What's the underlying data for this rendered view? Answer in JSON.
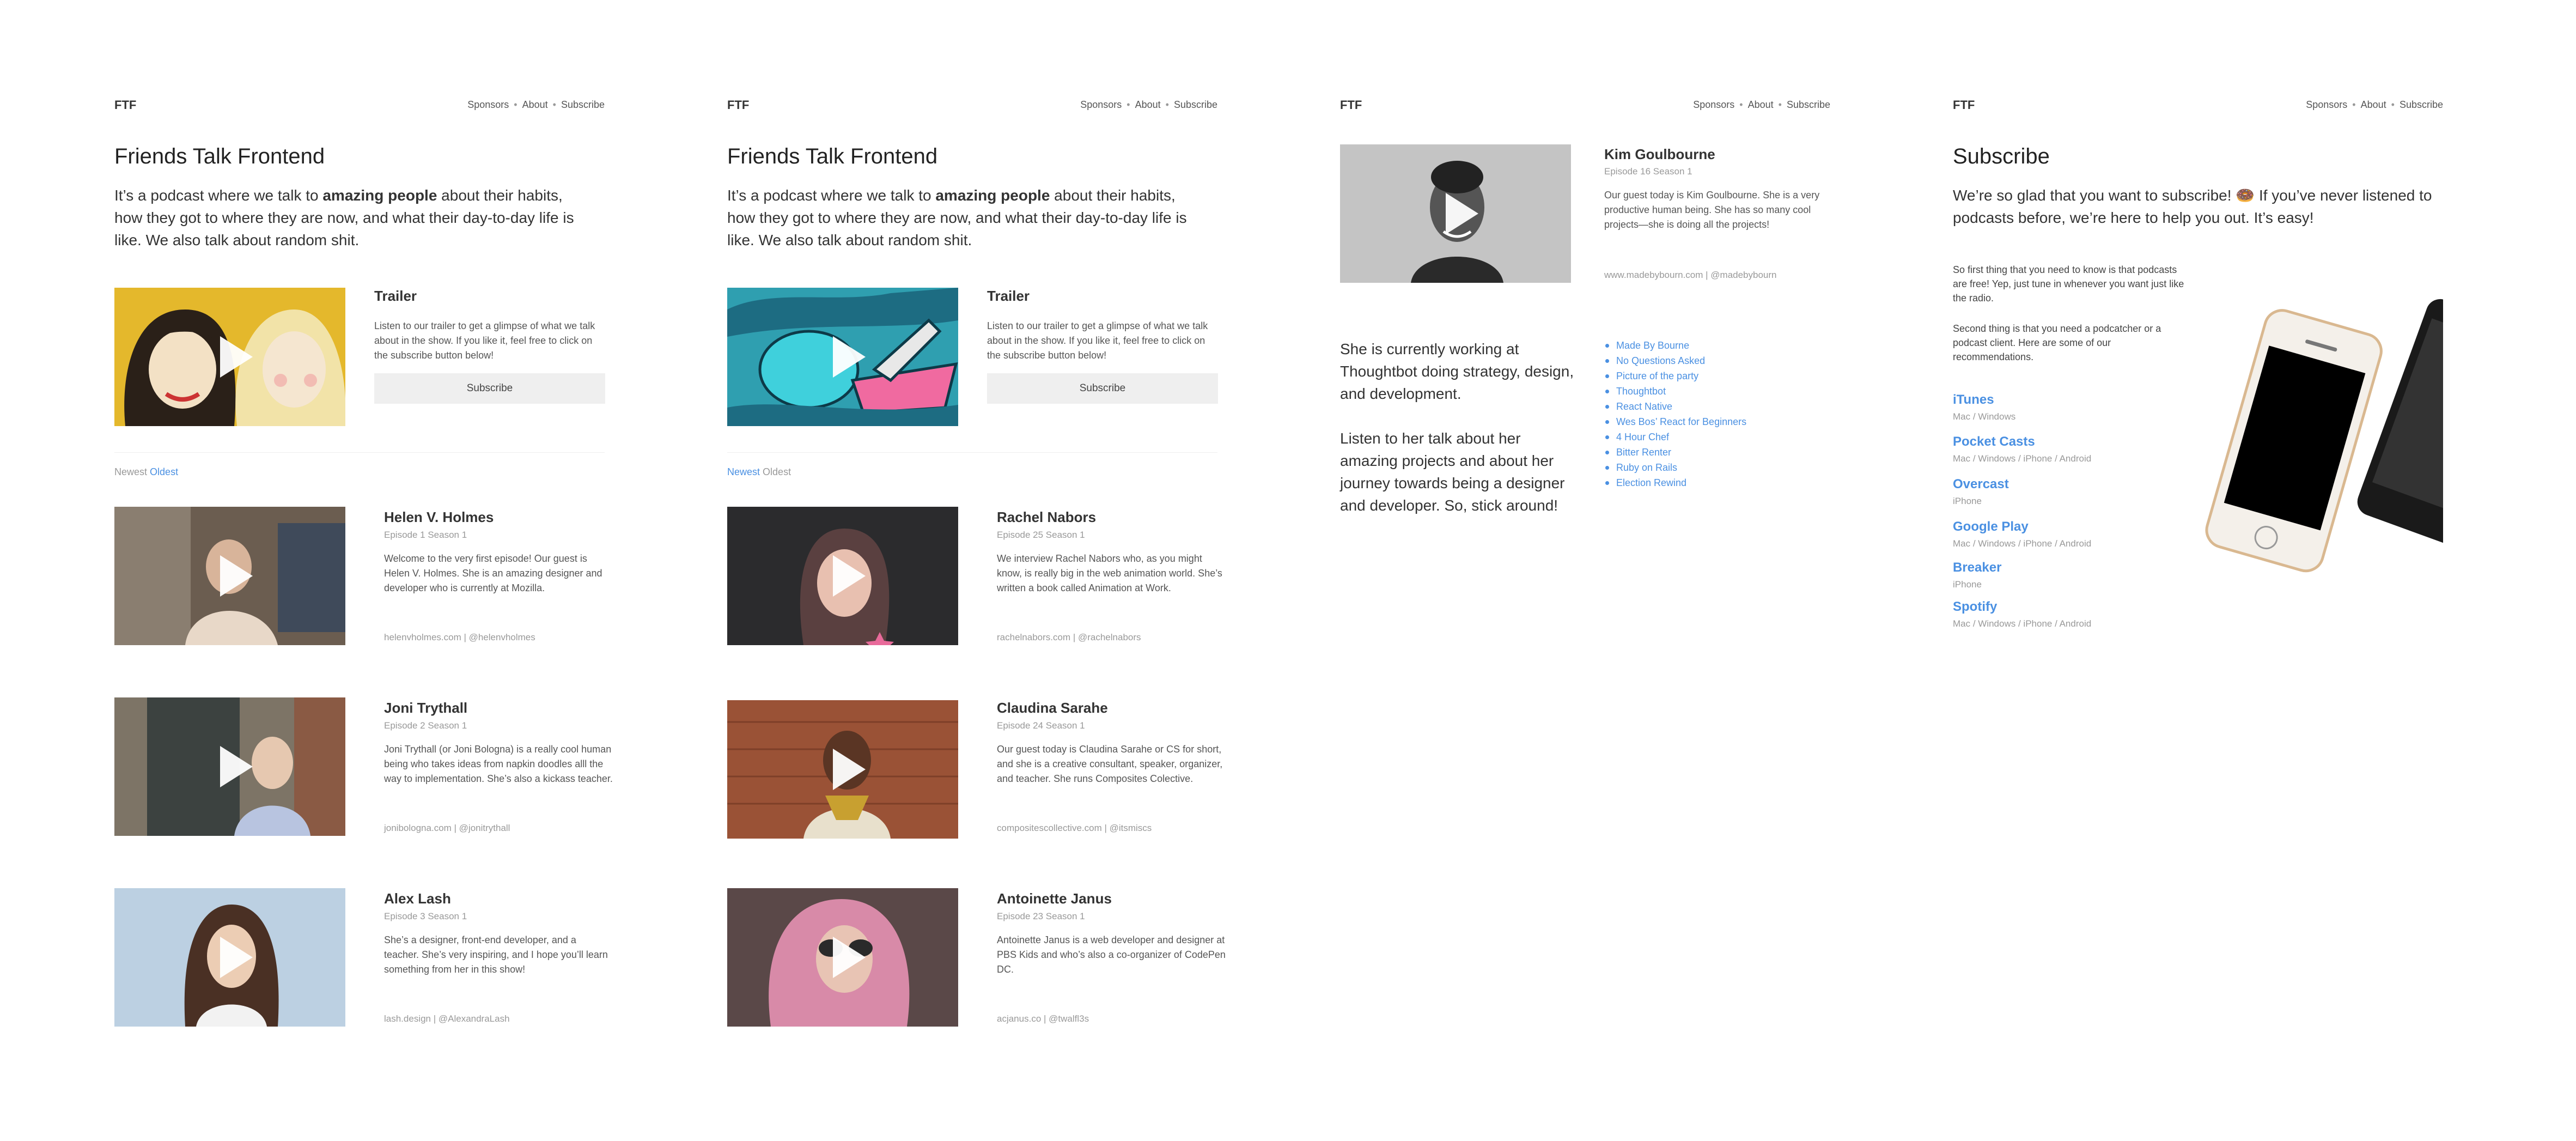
{
  "common": {
    "logo": "FTF",
    "nav": [
      "Sponsors",
      "About",
      "Subscribe"
    ],
    "nav_sep": "•",
    "site_title": "Friends Talk Frontend",
    "intro_a": "It’s a podcast where we talk to ",
    "intro_b": "amazing people",
    "intro_c": " about their habits, how they got to where they are now, and what their day-to-day life is like. We also talk about random shit.",
    "trailer_title": "Trailer",
    "trailer_text": "Listen to our trailer to get a glimpse of what we talk about in the show. If you like it, feel free to click on the subscribe button below!",
    "subscribe_button": "Subscribe",
    "sort_newest": "Newest",
    "sort_oldest": "Oldest"
  },
  "panel1": {
    "episodes": [
      {
        "name": "Helen V. Holmes",
        "meta": "Episode 1 Season 1",
        "desc": "Welcome to the very first episode! Our guest is Helen V. Holmes. She is an amazing designer and developer who is currently at Mozilla.",
        "links": "helenvholmes.com | @helenvholmes"
      },
      {
        "name": "Joni Trythall",
        "meta": "Episode 2 Season 1",
        "desc": "Joni Trythall (or Joni Bologna) is a really cool human being who takes ideas from napkin doodles alll the way to implementation. She’s also a kickass teacher.",
        "links": "jonibologna.com | @jonitrythall"
      },
      {
        "name": "Alex Lash",
        "meta": "Episode 3 Season 1",
        "desc": "She’s a designer, front-end developer, and a teacher. She’s very inspiring, and I hope you’ll learn something from her in this show!",
        "links": "lash.design | @AlexandraLash"
      }
    ]
  },
  "panel2": {
    "episodes": [
      {
        "name": "Rachel Nabors",
        "meta": "Episode 25 Season 1",
        "desc": "We interview Rachel Nabors who, as you might know, is really big in the web animation world. She’s written a book called Animation at Work.",
        "links": "rachelnabors.com | @rachelnabors"
      },
      {
        "name": "Claudina Sarahe",
        "meta": "Episode 24 Season 1",
        "desc": "Our guest today is Claudina Sarahe or CS for short, and she is a creative consultant, speaker, organizer, and teacher. She runs Composites Colective.",
        "links": "compositescollective.com | @itsmiscs"
      },
      {
        "name": "Antoinette Janus",
        "meta": "Episode 23 Season 1",
        "desc": "Antoinette Janus is a web developer and designer at PBS Kids and who’s also a co-organizer of CodePen DC.",
        "links": "acjanus.co | @twalfl3s"
      }
    ]
  },
  "panel3": {
    "name": "Kim Goulbourne",
    "meta": "Episode 16 Season 1",
    "desc": "Our guest today is Kim Goulbourne. She is a very productive human being. She has so many cool projects—she is doing all the projects!",
    "links": "www.madebybourn.com | @madebybourn",
    "about_1": "She is currently working at Thoughtbot doing strategy, design, and development.",
    "about_2": "Listen to her talk about her amazing projects and about her journey towards being a designer and developer. So, stick around!",
    "projects": [
      "Made By Bourne",
      "No Questions Asked",
      "Picture of the party",
      "Thoughtbot",
      "React Native",
      "Wes Bos’ React for Beginners",
      "4 Hour Chef",
      "Bitter Renter",
      "Ruby on Rails",
      "Election Rewind"
    ]
  },
  "panel4": {
    "title": "Subscribe",
    "intro": "We’re so glad that you want to subscribe! 🍩 If you’ve never listened to podcasts before, we’re here to help you out. It’s easy!",
    "text_1": "So first thing that you need to know is that podcasts are free! Yep, just tune in whenever you want just like the radio.",
    "text_2": "Second thing is that you need a podcatcher or a podcast client. Here are some of our recommendations.",
    "apps": [
      {
        "name": "iTunes",
        "platforms": "Mac / Windows"
      },
      {
        "name": "Pocket Casts",
        "platforms": "Mac / Windows / iPhone / Android"
      },
      {
        "name": "Overcast",
        "platforms": "iPhone"
      },
      {
        "name": "Google Play",
        "platforms": "Mac / Windows / iPhone / Android"
      },
      {
        "name": "Breaker",
        "platforms": "iPhone"
      },
      {
        "name": "Spotify",
        "platforms": "Mac / Windows / iPhone / Android"
      }
    ]
  },
  "colors": {
    "accent": "#4a90e2",
    "muted": "#999999",
    "button_bg": "#efefef"
  }
}
